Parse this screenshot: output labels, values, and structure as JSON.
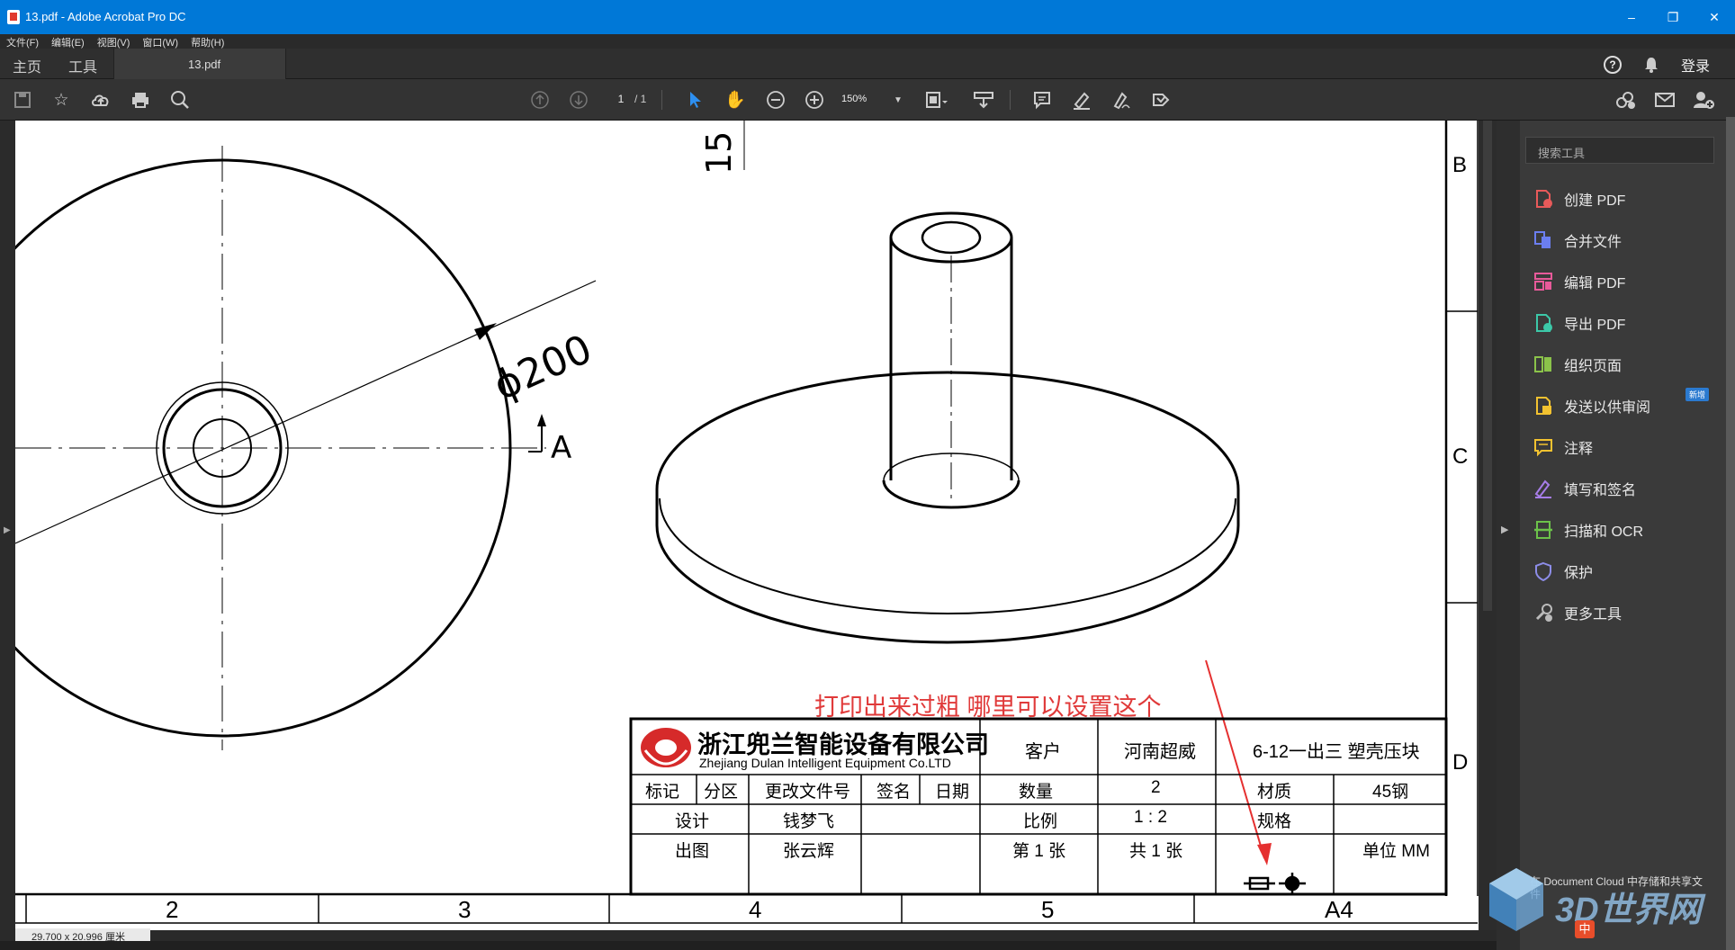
{
  "window": {
    "title": "13.pdf - Adobe Acrobat Pro DC",
    "minimize": "–",
    "restore": "❐",
    "close": "✕"
  },
  "menu": [
    "文件(F)",
    "编辑(E)",
    "视图(V)",
    "窗口(W)",
    "帮助(H)"
  ],
  "tabs": {
    "home": "主页",
    "tools": "工具",
    "document": "13.pdf",
    "help_icon": "?",
    "login": "登录"
  },
  "toolbar": {
    "page_current": "1",
    "page_total": "/ 1",
    "zoom": "150%"
  },
  "right_panel": {
    "search_placeholder": "搜索工具",
    "tools": [
      {
        "label": "创建 PDF",
        "icon": "create-pdf-icon",
        "color": "#e85a5a"
      },
      {
        "label": "合并文件",
        "icon": "combine-files-icon",
        "color": "#6b7ef0"
      },
      {
        "label": "编辑 PDF",
        "icon": "edit-pdf-icon",
        "color": "#e85a9a"
      },
      {
        "label": "导出 PDF",
        "icon": "export-pdf-icon",
        "color": "#3cc8a8"
      },
      {
        "label": "组织页面",
        "icon": "organize-pages-icon",
        "color": "#8bc34a"
      },
      {
        "label": "发送以供审阅",
        "icon": "send-review-icon",
        "color": "#f2c230"
      },
      {
        "label": "注释",
        "icon": "comment-icon",
        "color": "#f2c230"
      },
      {
        "label": "填写和签名",
        "icon": "fill-sign-icon",
        "color": "#a77de8"
      },
      {
        "label": "扫描和 OCR",
        "icon": "scan-ocr-icon",
        "color": "#6cc24a"
      },
      {
        "label": "保护",
        "icon": "protect-icon",
        "color": "#8d8de8"
      },
      {
        "label": "更多工具",
        "icon": "more-tools-icon",
        "color": "#bbbbbb"
      }
    ],
    "new_badge": "新增",
    "cloud_note": "在 Document Cloud 中存储和共享文件"
  },
  "drawing": {
    "dim_15": "15",
    "dim_phi200": "ϕ200",
    "section_A": "A",
    "row_B": "B",
    "row_C": "C",
    "row_D": "D",
    "col_2": "2",
    "col_3": "3",
    "col_4": "4",
    "col_5": "5",
    "col_A4": "A4",
    "annotation": "打印出来过粗 哪里可以设置这个",
    "company_cn": "浙江兜兰智能设备有限公司",
    "company_en": "Zhejiang Dulan Intelligent Equipment Co.LTD",
    "customer_label": "客户",
    "customer_value": "河南超威",
    "part_name": "6-12一出三 塑壳压块",
    "h_mark": "标记",
    "h_zone": "分区",
    "h_change": "更改文件号",
    "h_sign": "签名",
    "h_date": "日期",
    "qty_label": "数量",
    "qty_value": "2",
    "material_label": "材质",
    "material_value": "45钢",
    "design_label": "设计",
    "design_value": "钱梦飞",
    "scale_label": "比例",
    "scale_value": "1 : 2",
    "spec_label": "规格",
    "drawn_label": "出图",
    "drawn_value": "张云辉",
    "sheet_label": "第 1 张",
    "sheets_total": "共 1 张",
    "unit_label": "单位 MM"
  },
  "status": {
    "page_size": "29.700 x 20.996 厘米"
  },
  "watermark": {
    "text": "3D世界网",
    "ime": "中"
  }
}
